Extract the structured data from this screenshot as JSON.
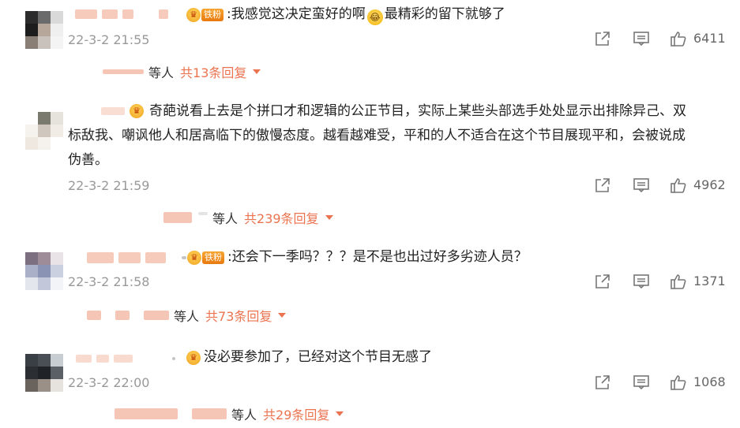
{
  "comments": [
    {
      "badge": "铁粉",
      "text": ":我感觉这决定蛮好的啊",
      "text_after_emoji": "最精彩的留下就够了",
      "time": "22-3-2 21:55",
      "likes": "6411",
      "reply": {
        "who": "等人",
        "total": "共13条回复"
      }
    },
    {
      "text": "奇葩说看上去是个拼口才和逻辑的公正节目，实际上某些头部选手处处显示出排除异己、双",
      "text_line2": "标敌我、嘲讽他人和居高临下的傲慢态度。越看越难受，平和的人不适合在这个节目展现平和，会被说成",
      "text_line3": "伪善。",
      "time": "22-3-2 21:59",
      "likes": "4962",
      "reply": {
        "who": "等人",
        "total": "共239条回复"
      }
    },
    {
      "badge": "铁粉",
      "text": ":还会下一季吗？？？是不是也出过好多劣迹人员？",
      "time": "22-3-2 21:58",
      "likes": "1371",
      "reply": {
        "who": "等人",
        "total": "共73条回复"
      }
    },
    {
      "text": "没必要参加了，已经对这个节目无感了",
      "time": "22-3-2 22:00",
      "likes": "1068",
      "reply": {
        "who": "等人",
        "total": "共29条回复"
      }
    }
  ],
  "icons": {
    "share": "share-icon",
    "comment": "comment-icon",
    "like": "thumbs-up-icon"
  },
  "colors": {
    "accent": "#eb7350",
    "muted": "#999999"
  }
}
